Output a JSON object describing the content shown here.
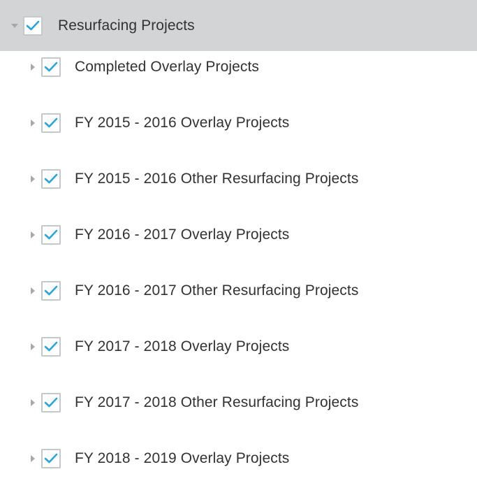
{
  "layers": {
    "parent": {
      "label": "Resurfacing Projects",
      "expanded": true,
      "checked": true
    },
    "children": [
      {
        "label": "Completed Overlay Projects",
        "checked": true,
        "expanded": false
      },
      {
        "label": "FY 2015 - 2016 Overlay Projects",
        "checked": true,
        "expanded": false
      },
      {
        "label": "FY 2015 - 2016 Other Resurfacing Projects",
        "checked": true,
        "expanded": false
      },
      {
        "label": "FY 2016 - 2017 Overlay Projects",
        "checked": true,
        "expanded": false
      },
      {
        "label": "FY 2016 - 2017 Other Resurfacing Projects",
        "checked": true,
        "expanded": false
      },
      {
        "label": "FY 2017 - 2018 Overlay Projects",
        "checked": true,
        "expanded": false
      },
      {
        "label": "FY 2017 - 2018 Other Resurfacing Projects",
        "checked": true,
        "expanded": false
      },
      {
        "label": "FY 2018 - 2019 Overlay Projects",
        "checked": true,
        "expanded": false
      }
    ]
  },
  "colors": {
    "header_bg": "#d3d4d6",
    "check": "#2aa3dd",
    "checkbox_border": "#c4c9cf",
    "arrow": "#a8a8a8",
    "text": "#323232"
  },
  "icons": {
    "expanded": "caret-down-icon",
    "collapsed": "caret-right-icon",
    "check": "checkmark-icon"
  }
}
